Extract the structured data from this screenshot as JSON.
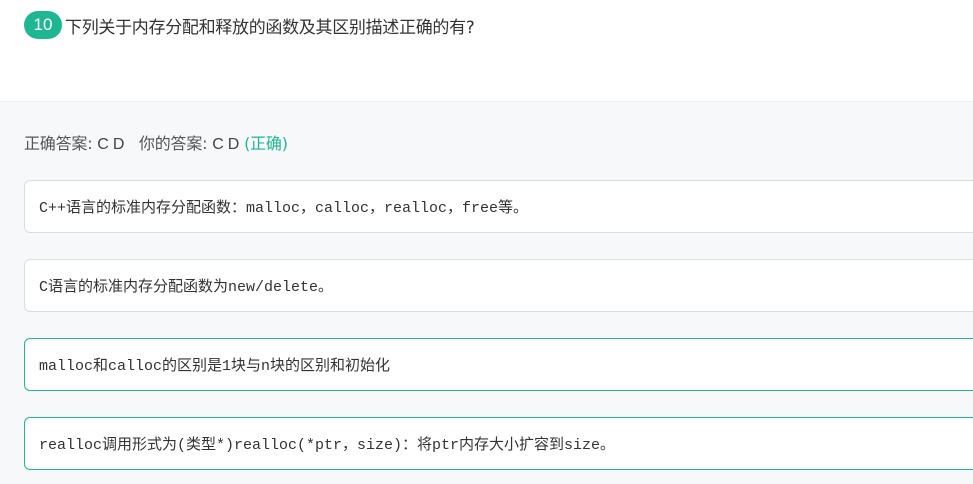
{
  "question": {
    "number": "10",
    "text": "下列关于内存分配和释放的函数及其区别描述正确的有?"
  },
  "result": {
    "correct_label": "正确答案: ",
    "correct_value": "C D",
    "your_label": "你的答案: ",
    "your_value": "C D",
    "status": "(正确)"
  },
  "options": [
    {
      "text": "C++语言的标准内存分配函数：malloc，calloc，realloc，free等。",
      "correct": false
    },
    {
      "text": "C语言的标准内存分配函数为new/delete。",
      "correct": false
    },
    {
      "text": "malloc和calloc的区别是1块与n块的区别和初始化",
      "correct": true
    },
    {
      "text": "realloc调用形式为(类型*)realloc(*ptr，size)：将ptr内存大小扩容到size。",
      "correct": true
    }
  ],
  "colors": {
    "accent": "#1fb693",
    "border": "#dcdcdc",
    "panel_bg": "#f7f8fa",
    "text": "#333333"
  }
}
